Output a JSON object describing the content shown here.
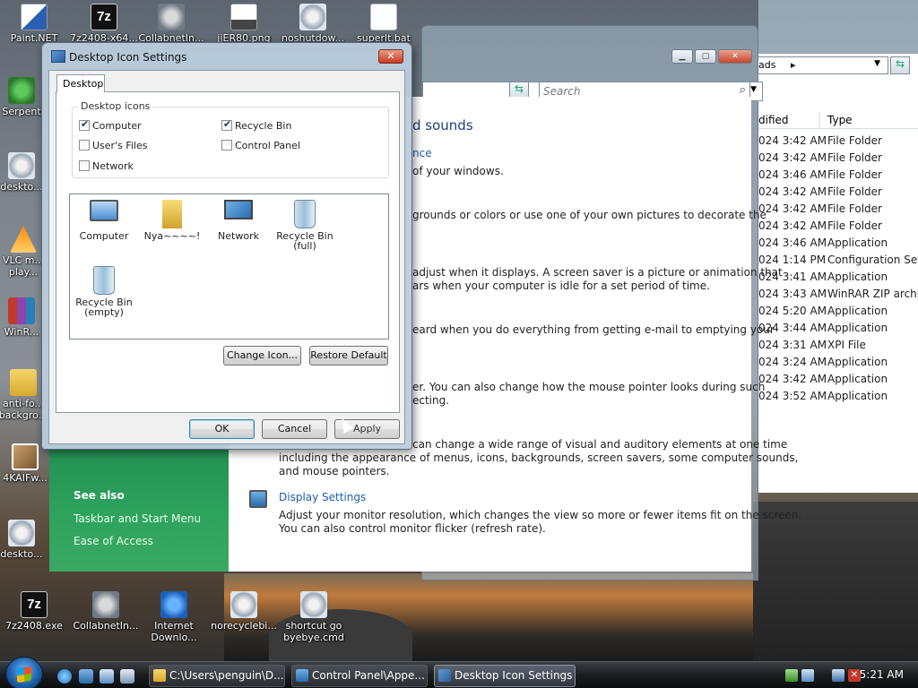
{
  "desktop_icons": {
    "top_row": [
      {
        "label": "Paint.NET",
        "icon": "paint-net-icon"
      },
      {
        "label": "7z2408-x64...",
        "icon": "7zip-icon"
      },
      {
        "label": "CollabnetIn...",
        "icon": "installer-icon"
      },
      {
        "label": "jjER80.png",
        "icon": "image-icon"
      },
      {
        "label": "noshutdow...",
        "icon": "gear-icon"
      },
      {
        "label": "superlt.bat",
        "icon": "document-icon"
      }
    ],
    "left_column": [
      {
        "label": "Serpent",
        "icon": "snake-icon"
      },
      {
        "label": "deskto...",
        "icon": "gear-icon"
      },
      {
        "label": "VLC m... play...",
        "icon": "vlc-icon"
      },
      {
        "label": "WinR...",
        "icon": "winrar-icon"
      },
      {
        "label": "anti-fo... backgro...",
        "icon": "folder-icon"
      },
      {
        "label": "4KAIFw...",
        "icon": "photo-icon"
      },
      {
        "label": "deskto...",
        "icon": "gear-icon"
      }
    ],
    "bottom_row": [
      {
        "label": "7z2408.exe",
        "icon": "7zip-icon"
      },
      {
        "label": "CollabnetIn...",
        "icon": "installer-icon"
      },
      {
        "label": "Internet Downlo...",
        "icon": "internet-download-icon"
      },
      {
        "label": "norecyclebi...",
        "icon": "gear-icon"
      },
      {
        "label": "shortcut go byebye.cmd",
        "icon": "gear-icon"
      }
    ]
  },
  "dialog": {
    "title": "Desktop Icon Settings",
    "close": "✕",
    "tab": "Desktop",
    "group_label": "Desktop icons",
    "checkboxes": [
      {
        "label": "Computer",
        "checked": true
      },
      {
        "label": "Recycle Bin",
        "checked": true
      },
      {
        "label": "User's Files",
        "checked": false
      },
      {
        "label": "Control Panel",
        "checked": false
      },
      {
        "label": "Network",
        "checked": false
      }
    ],
    "icons": [
      {
        "label": "Computer",
        "icon": "computer-icon"
      },
      {
        "label": "Nya~~~~!",
        "icon": "user-folder-icon"
      },
      {
        "label": "Network",
        "icon": "network-icon"
      },
      {
        "label": "Recycle Bin",
        "sub": "(full)",
        "icon": "recycle-bin-full-icon"
      },
      {
        "label": "Recycle Bin",
        "sub": "(empty)",
        "icon": "recycle-bin-empty-icon"
      }
    ],
    "change_icon": "Change Icon...",
    "restore_default": "Restore Default",
    "ok": "OK",
    "cancel": "Cancel",
    "apply": "Apply"
  },
  "control_panel": {
    "search_placeholder": "Search",
    "heading": "d sounds",
    "sections": [
      {
        "link": "nce",
        "lines": [
          "of your windows."
        ]
      },
      {
        "lines": [
          "grounds or colors or use one of your own pictures to decorate the"
        ]
      },
      {
        "lines": [
          "adjust when it displays. A screen saver is a picture or animation that",
          "ars when your computer is idle for a set period of time."
        ]
      },
      {
        "lines": [
          "eard when you do everything from getting e-mail to emptying your"
        ]
      },
      {
        "lines": [
          "er. You can also change how the mouse pointer looks during such",
          "ecting."
        ]
      },
      {
        "lines": [
          "can change a wide range of visual and auditory elements at one time",
          "including the appearance of menus, icons, backgrounds, screen savers, some computer sounds,",
          "and mouse pointers."
        ]
      }
    ],
    "display_settings": {
      "title": "Display Settings",
      "lines": [
        "Adjust your monitor resolution, which changes the view so more or fewer items fit on the screen.",
        "You can also control monitor flicker (refresh rate)."
      ]
    },
    "see_also": {
      "heading": "See also",
      "links": [
        "Taskbar and Start Menu",
        "Ease of Access"
      ]
    }
  },
  "explorer": {
    "address": "ads",
    "columns": [
      "dified",
      "Type"
    ],
    "rows": [
      {
        "date": "024 3:42 AM",
        "type": "File Folder"
      },
      {
        "date": "024 3:42 AM",
        "type": "File Folder"
      },
      {
        "date": "024 3:46 AM",
        "type": "File Folder"
      },
      {
        "date": "024 3:42 AM",
        "type": "File Folder"
      },
      {
        "date": "024 3:42 AM",
        "type": "File Folder"
      },
      {
        "date": "024 3:42 AM",
        "type": "File Folder"
      },
      {
        "date": "024 3:46 AM",
        "type": "Application"
      },
      {
        "date": "024 1:14 PM",
        "type": "Configuration Sett..."
      },
      {
        "date": "024 3:41 AM",
        "type": "Application"
      },
      {
        "date": "024 3:43 AM",
        "type": "WinRAR ZIP archive"
      },
      {
        "date": "024 5:20 AM",
        "type": "Application"
      },
      {
        "date": "024 3:44 AM",
        "type": "Application"
      },
      {
        "date": "024 3:31 AM",
        "type": "XPI File"
      },
      {
        "date": "024 3:24 AM",
        "type": "Application"
      },
      {
        "date": "024 3:42 AM",
        "type": "Application"
      },
      {
        "date": "024 3:52 AM",
        "type": "Application"
      }
    ]
  },
  "taskbar": {
    "buttons": [
      {
        "label": "C:\\Users\\penguin\\D...",
        "active": false
      },
      {
        "label": "Control Panel\\Appe...",
        "active": false
      },
      {
        "label": "Desktop Icon Settings",
        "active": true
      }
    ],
    "clock": "5:21 AM"
  },
  "colors": {
    "accent_green": "#2ea35e",
    "link_blue": "#1c5cac",
    "taskbar": "#1b1d20"
  }
}
